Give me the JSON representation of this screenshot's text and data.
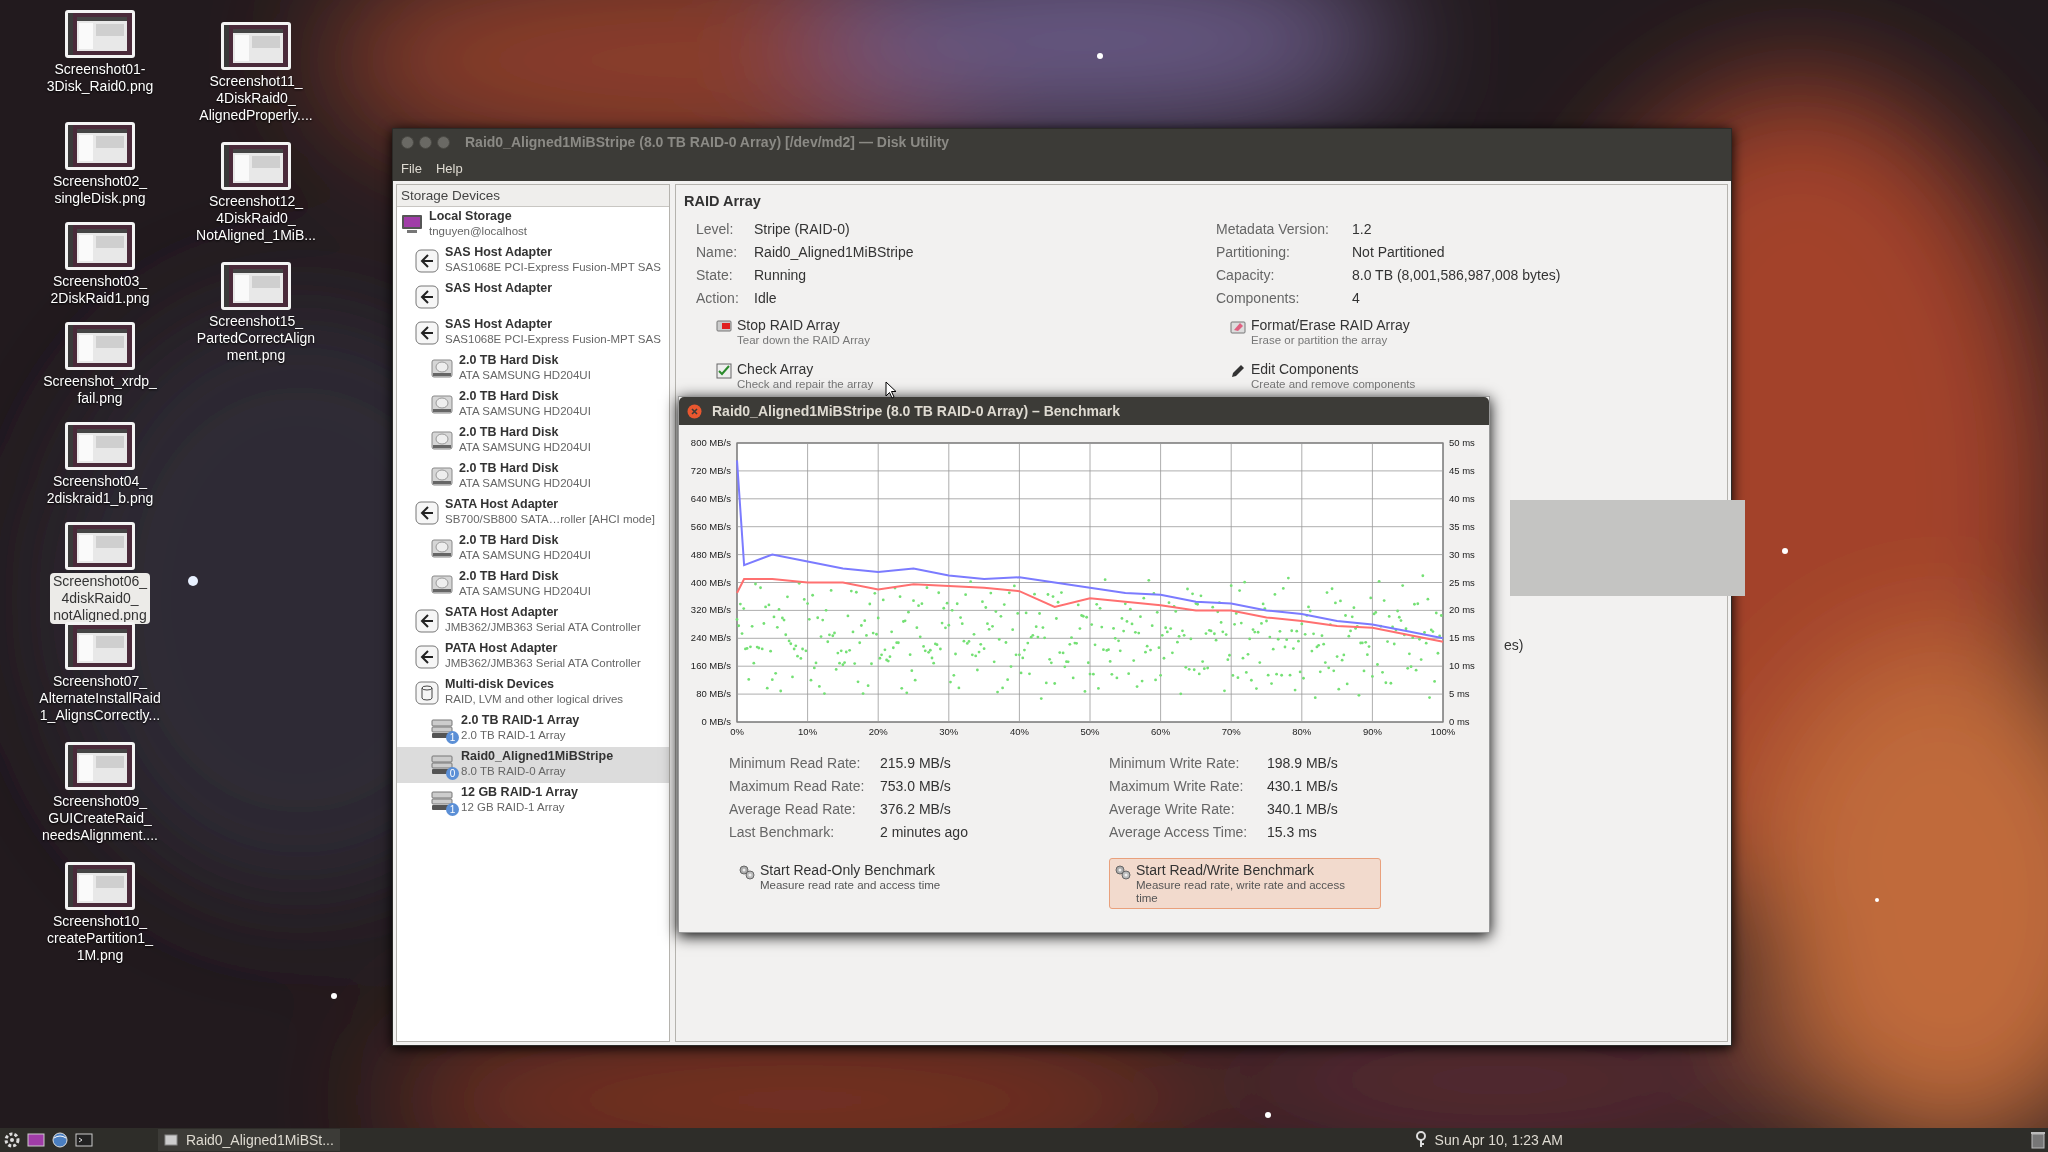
{
  "desktop": {
    "icons": [
      {
        "label": "Screenshot01-\n3Disk_Raid0.png",
        "selected": false
      },
      {
        "label": "Screenshot02_\nsingleDisk.png",
        "selected": false
      },
      {
        "label": "Screenshot03_\n2DiskRaid1.png",
        "selected": false
      },
      {
        "label": "Screenshot_xrdp_\nfail.png",
        "selected": false
      },
      {
        "label": "Screenshot04_\n2diskraid1_b.png",
        "selected": false
      },
      {
        "label": "Screenshot06_\n4diskRaid0_\nnotAligned.png",
        "selected": true
      },
      {
        "label": "Screenshot07_\nAlternateInstallRaid\n1_AlignsCorrectly...",
        "selected": false
      },
      {
        "label": "Screenshot09_\nGUICreateRaid_\nneedsAlignment....",
        "selected": false
      },
      {
        "label": "Screenshot10_\ncreatePartition1_\n1M.png",
        "selected": false
      },
      {
        "label": "Screenshot11_\n4DiskRaid0_\nAlignedProperly....",
        "selected": false
      },
      {
        "label": "Screenshot12_\n4DiskRaid0_\nNotAligned_1MiB...",
        "selected": false
      },
      {
        "label": "Screenshot15_\nPartedCorrectAlign\nment.png",
        "selected": false
      }
    ]
  },
  "window": {
    "title": "Raid0_Aligned1MiBStripe (8.0 TB RAID-0 Array) [/dev/md2] — Disk Utility",
    "menu": [
      "File",
      "Help"
    ],
    "sidebar": {
      "header": "Storage Devices",
      "items": [
        {
          "kind": "computer",
          "title": "Local Storage",
          "subtitle": "tnguyen@localhost",
          "selected": false,
          "children": [
            {
              "kind": "adapter",
              "title": "SAS Host Adapter",
              "subtitle": "SAS1068E PCI-Express Fusion-MPT SAS",
              "selected": false
            },
            {
              "kind": "adapter",
              "title": "SAS Host Adapter",
              "selected": false
            },
            {
              "kind": "adapter",
              "title": "SAS Host Adapter",
              "subtitle": "SAS1068E PCI-Express Fusion-MPT SAS",
              "selected": false,
              "children": [
                {
                  "kind": "disk",
                  "title": "2.0 TB Hard Disk",
                  "subtitle": "ATA SAMSUNG HD204UI",
                  "selected": false
                },
                {
                  "kind": "disk",
                  "title": "2.0 TB Hard Disk",
                  "subtitle": "ATA SAMSUNG HD204UI",
                  "selected": false
                },
                {
                  "kind": "disk",
                  "title": "2.0 TB Hard Disk",
                  "subtitle": "ATA SAMSUNG HD204UI",
                  "selected": false
                },
                {
                  "kind": "disk",
                  "title": "2.0 TB Hard Disk",
                  "subtitle": "ATA SAMSUNG HD204UI",
                  "selected": false
                }
              ]
            },
            {
              "kind": "adapter",
              "title": "SATA Host Adapter",
              "subtitle": "SB700/SB800 SATA…roller [AHCI mode]",
              "selected": false,
              "children": [
                {
                  "kind": "disk",
                  "title": "2.0 TB Hard Disk",
                  "subtitle": "ATA SAMSUNG HD204UI",
                  "selected": false
                },
                {
                  "kind": "disk",
                  "title": "2.0 TB Hard Disk",
                  "subtitle": "ATA SAMSUNG HD204UI",
                  "selected": false
                }
              ]
            },
            {
              "kind": "adapter",
              "title": "SATA Host Adapter",
              "subtitle": "JMB362/JMB363 Serial ATA Controller",
              "selected": false
            },
            {
              "kind": "adapter",
              "title": "PATA Host Adapter",
              "subtitle": "JMB362/JMB363 Serial ATA Controller",
              "selected": false
            },
            {
              "kind": "multidisk",
              "title": "Multi-disk Devices",
              "subtitle": "RAID, LVM and other logical drives",
              "selected": false,
              "children": [
                {
                  "kind": "raid",
                  "title": "2.0 TB RAID-1 Array",
                  "subtitle": "2.0 TB RAID-1 Array",
                  "badge": "1",
                  "selected": false
                },
                {
                  "kind": "raid",
                  "title": "Raid0_Aligned1MiBStripe",
                  "subtitle": "8.0 TB RAID-0 Array",
                  "badge": "0",
                  "selected": true
                },
                {
                  "kind": "raid",
                  "title": "12 GB RAID-1 Array",
                  "subtitle": "12 GB RAID-1 Array",
                  "badge": "1",
                  "selected": false
                }
              ]
            }
          ]
        }
      ]
    },
    "content": {
      "heading": "RAID Array",
      "fields_left": [
        {
          "label": "Level:",
          "value": "Stripe (RAID-0)"
        },
        {
          "label": "Name:",
          "value": "Raid0_Aligned1MiBStripe"
        },
        {
          "label": "State:",
          "value": "Running"
        },
        {
          "label": "Action:",
          "value": "Idle"
        }
      ],
      "fields_right": [
        {
          "label": "Metadata Version:",
          "value": "1.2"
        },
        {
          "label": "Partitioning:",
          "value": "Not Partitioned"
        },
        {
          "label": "Capacity:",
          "value": "8.0 TB (8,001,586,987,008 bytes)"
        },
        {
          "label": "Components:",
          "value": "4"
        }
      ],
      "actions": [
        {
          "kind": "stop",
          "title": "Stop RAID Array",
          "subtitle": "Tear down the RAID Array"
        },
        {
          "kind": "format",
          "title": "Format/Erase RAID Array",
          "subtitle": "Erase or partition the array"
        },
        {
          "kind": "check",
          "title": "Check Array",
          "subtitle": "Check and repair the array"
        },
        {
          "kind": "edit",
          "title": "Edit Components",
          "subtitle": "Create and remove components"
        }
      ],
      "partial_text": "es)"
    }
  },
  "benchmark_dialog": {
    "title": "Raid0_Aligned1MiBStripe (8.0 TB RAID-0 Array) – Benchmark",
    "chart_data": {
      "type": "line",
      "x": [
        0,
        1,
        5,
        10,
        15,
        20,
        25,
        30,
        35,
        40,
        45,
        50,
        55,
        60,
        65,
        70,
        75,
        80,
        85,
        90,
        95,
        100
      ],
      "series": [
        {
          "color": "#7b7bff",
          "values": [
            750,
            450,
            480,
            460,
            440,
            430,
            440,
            420,
            410,
            415,
            400,
            385,
            370,
            365,
            345,
            340,
            320,
            310,
            290,
            280,
            260,
            240
          ]
        },
        {
          "color": "#ff7070",
          "values": [
            370,
            410,
            410,
            400,
            400,
            380,
            395,
            390,
            385,
            375,
            330,
            355,
            345,
            335,
            320,
            320,
            300,
            290,
            275,
            270,
            250,
            230
          ]
        }
      ],
      "xlim": [
        0,
        100
      ],
      "ylim": [
        0,
        800
      ],
      "grid": true,
      "xticks": [
        {
          "value": 0,
          "label": "0%"
        },
        {
          "value": 10,
          "label": "10%"
        },
        {
          "value": 20,
          "label": "20%"
        },
        {
          "value": 30,
          "label": "30%"
        },
        {
          "value": 40,
          "label": "40%"
        },
        {
          "value": 50,
          "label": "50%"
        },
        {
          "value": 60,
          "label": "60%"
        },
        {
          "value": 70,
          "label": "70%"
        },
        {
          "value": 80,
          "label": "80%"
        },
        {
          "value": 90,
          "label": "90%"
        },
        {
          "value": 100,
          "label": "100%"
        }
      ],
      "yticks": [
        {
          "value": 0,
          "label": "0 MB/s"
        },
        {
          "value": 80,
          "label": "80 MB/s"
        },
        {
          "value": 160,
          "label": "160 MB/s"
        },
        {
          "value": 240,
          "label": "240 MB/s"
        },
        {
          "value": 320,
          "label": "320 MB/s"
        },
        {
          "value": 400,
          "label": "400 MB/s"
        },
        {
          "value": 480,
          "label": "480 MB/s"
        },
        {
          "value": 560,
          "label": "560 MB/s"
        },
        {
          "value": 640,
          "label": "640 MB/s"
        },
        {
          "value": 720,
          "label": "720 MB/s"
        },
        {
          "value": 800,
          "label": "800 MB/s"
        }
      ]
    },
    "access_time_ticks": [
      "50 ms",
      "45 ms",
      "40 ms",
      "35 ms",
      "30 ms",
      "25 ms",
      "20 ms",
      "15 ms",
      "10 ms",
      "5 ms",
      "0 ms"
    ],
    "stats_left": [
      {
        "label": "Minimum Read Rate:",
        "value": "215.9 MB/s"
      },
      {
        "label": "Maximum Read Rate:",
        "value": "753.0 MB/s"
      },
      {
        "label": "Average Read Rate:",
        "value": "376.2 MB/s"
      },
      {
        "label": "Last Benchmark:",
        "value": "2 minutes ago"
      }
    ],
    "stats_right": [
      {
        "label": "Minimum Write Rate:",
        "value": "198.9 MB/s"
      },
      {
        "label": "Maximum Write Rate:",
        "value": "430.1 MB/s"
      },
      {
        "label": "Average Write Rate:",
        "value": "340.1 MB/s"
      },
      {
        "label": "Average Access Time:",
        "value": "15.3 ms"
      }
    ],
    "buttons": [
      {
        "title": "Start Read-Only Benchmark",
        "subtitle": "Measure read rate and access time",
        "highlighted": false
      },
      {
        "title": "Start Read/Write Benchmark",
        "subtitle": "Measure read rate, write rate and access time",
        "highlighted": true
      }
    ]
  },
  "taskbar": {
    "window_button": "Raid0_Aligned1MiBSt...",
    "clock": "Sun Apr 10, 1:23 AM"
  }
}
